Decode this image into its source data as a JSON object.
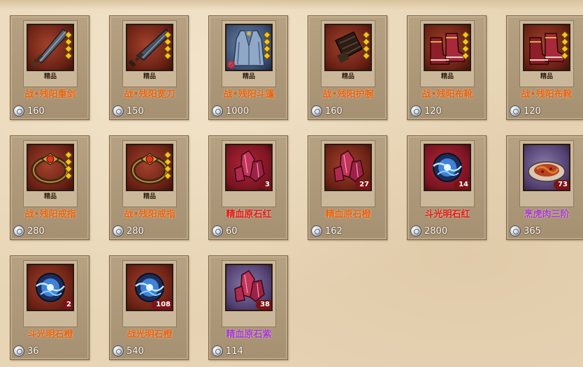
{
  "colors": {
    "orange": "#e8620f",
    "red": "#e11a1a",
    "purple": "#a43ad6",
    "gold_diamond": "#f2c51a"
  },
  "items": [
    {
      "name": "战•残阳重剑",
      "price": "160",
      "quality": "精品",
      "icon": "greatsword-icon",
      "bg": "red",
      "name_color": "orange",
      "diamonds": 4
    },
    {
      "name": "战•残阳宽刀",
      "price": "150",
      "quality": "精品",
      "icon": "broad-blade-icon",
      "bg": "red",
      "name_color": "orange",
      "diamonds": 4
    },
    {
      "name": "战•残阳斗篷",
      "price": "1000",
      "quality": "精品",
      "icon": "cloak-icon",
      "bg": "blue",
      "name_color": "orange",
      "diamonds": 4,
      "restricted": true
    },
    {
      "name": "战•残阳护腕",
      "price": "160",
      "quality": "精品",
      "icon": "bracer-icon",
      "bg": "red",
      "name_color": "orange",
      "diamonds": 4
    },
    {
      "name": "战•残阳布靴",
      "price": "120",
      "quality": "精品",
      "icon": "boots-icon",
      "bg": "red",
      "name_color": "orange",
      "diamonds": 4
    },
    {
      "name": "战•残阳布靴",
      "price": "120",
      "quality": "精品",
      "icon": "boots-icon",
      "bg": "red",
      "name_color": "orange",
      "diamonds": 4
    },
    {
      "name": "战•残阳戒指",
      "price": "280",
      "quality": "精品",
      "icon": "ring-icon",
      "bg": "red",
      "name_color": "orange",
      "diamonds": 4
    },
    {
      "name": "战•残阳戒指",
      "price": "280",
      "quality": "精品",
      "icon": "ring-icon",
      "bg": "red",
      "name_color": "orange",
      "diamonds": 4
    },
    {
      "name": "精血原石红",
      "price": "60",
      "count": "3",
      "icon": "crystal-icon",
      "bg": "darkred",
      "name_color": "red"
    },
    {
      "name": "精血原石橙",
      "price": "162",
      "count": "27",
      "icon": "crystal-icon",
      "bg": "red",
      "name_color": "orange"
    },
    {
      "name": "斗光明石红",
      "price": "2800",
      "count": "14",
      "icon": "light-orb-icon",
      "bg": "darkred",
      "name_color": "red"
    },
    {
      "name": "烹虎肉三阶",
      "price": "365",
      "count": "73",
      "icon": "meat-dish-icon",
      "bg": "purple",
      "name_color": "purple"
    },
    {
      "name": "斗光明石橙",
      "price": "36",
      "count": "2",
      "icon": "light-orb-icon",
      "bg": "red",
      "name_color": "orange"
    },
    {
      "name": "战光明石橙",
      "price": "540",
      "count": "108",
      "icon": "light-orb-icon",
      "bg": "red",
      "name_color": "orange"
    },
    {
      "name": "精血原石紫",
      "price": "114",
      "count": "38",
      "icon": "crystal-icon",
      "bg": "purple",
      "name_color": "purple"
    }
  ]
}
